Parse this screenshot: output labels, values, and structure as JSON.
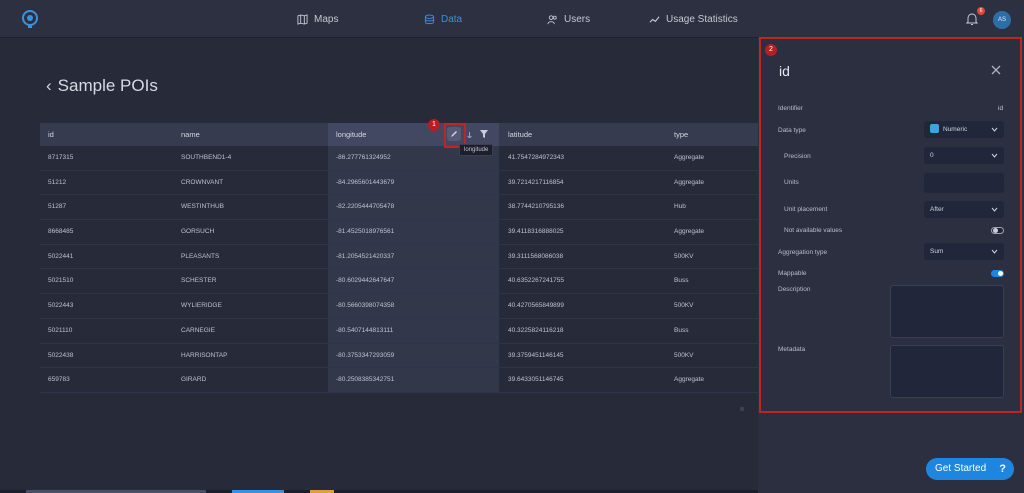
{
  "nav": {
    "maps": "Maps",
    "data": "Data",
    "users": "Users",
    "usage": "Usage Statistics",
    "notifications_count": "6",
    "avatar_initials": "AS"
  },
  "page": {
    "back": "‹",
    "title": "Sample POIs"
  },
  "table": {
    "headers": [
      "id",
      "name",
      "longitude",
      "latitude",
      "type"
    ],
    "tooltip": "longitude",
    "marker": "1",
    "rows": [
      [
        "8717315",
        "SOUTHBEND1-4",
        "-86.277761324952",
        "41.7547284972343",
        "Aggregate"
      ],
      [
        "51212",
        "CROWNVANT",
        "-84.2965601443679",
        "39.7214217116854",
        "Aggregate"
      ],
      [
        "51287",
        "WESTINTHUB",
        "-82.2205444705478",
        "38.7744210795136",
        "Hub"
      ],
      [
        "8668485",
        "GORSUCH",
        "-81.4525018976561",
        "39.4118316888025",
        "Aggregate"
      ],
      [
        "5022441",
        "PLEASANTS",
        "-81.2054521420337",
        "39.3111568086038",
        "500KV"
      ],
      [
        "5021510",
        "SCHESTER",
        "-80.6029442647647",
        "40.6352267241755",
        "Buss"
      ],
      [
        "5022443",
        "WYLIERIDGE",
        "-80.5660398074358",
        "40.4270565849899",
        "500KV"
      ],
      [
        "5021110",
        "CARNEGIE",
        "-80.5407144813111",
        "40.3225824116218",
        "Buss"
      ],
      [
        "5022438",
        "HARRISONTAP",
        "-80.3753347293059",
        "39.3759451146145",
        "500KV"
      ],
      [
        "659783",
        "GIRARD",
        "-80.2508385342751",
        "39.6433051146745",
        "Aggregate"
      ]
    ]
  },
  "panel": {
    "marker": "2",
    "title": "id",
    "identifier_label": "Identifier",
    "identifier_value": "id",
    "data_type_label": "Data type",
    "data_type_value": "Numeric",
    "precision_label": "Precision",
    "precision_value": "0",
    "units_label": "Units",
    "unit_placement_label": "Unit placement",
    "unit_placement_value": "After",
    "not_available_label": "Not available values",
    "not_available_on": false,
    "aggregation_label": "Aggregation type",
    "aggregation_value": "Sum",
    "mappable_label": "Mappable",
    "mappable_on": true,
    "description_label": "Description",
    "metadata_label": "Metadata"
  },
  "help": {
    "label": "Get Started",
    "icon": "?"
  },
  "colors": {
    "accent": "#1f86e0",
    "highlight": "#c22424"
  }
}
